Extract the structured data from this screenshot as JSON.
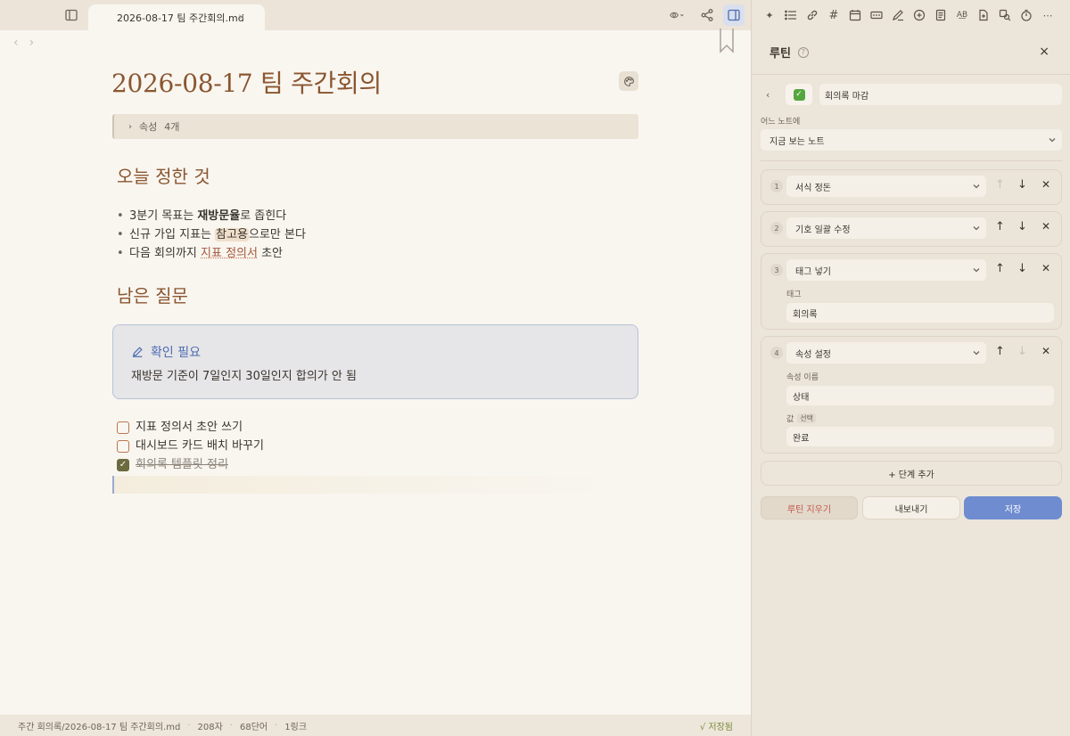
{
  "tab": {
    "title": "2026-08-17 팀 주간회의.md",
    "close": "×"
  },
  "editor": {
    "title": "2026-08-17 팀 주간회의",
    "properties": {
      "label": "속성",
      "count": "4개"
    },
    "heading1": "오늘 정한 것",
    "bullets": [
      {
        "pre": "3분기 목표는 ",
        "strong": "재방문율",
        "post": "로 좁힌다"
      },
      {
        "pre": "신규 가입 지표는 ",
        "mark": "참고용",
        "post": "으로만 본다"
      },
      {
        "pre": "다음 회의까지 ",
        "link": "지표 정의서",
        "post": " 초안"
      }
    ],
    "heading2": "남은 질문",
    "callout": {
      "title": "확인 필요",
      "body": "재방문 기준이 7일인지 30일인지 합의가 안 됨"
    },
    "tasks": [
      {
        "text": "지표 정의서 초안 쓰기",
        "done": false
      },
      {
        "text": "대시보드 카드 배치 바꾸기",
        "done": false
      },
      {
        "text": "회의록 템플릿 정리",
        "done": true
      }
    ]
  },
  "status": {
    "path": "주간 회의록/2026-08-17 팀 주간회의.md",
    "chars": "208자",
    "words": "68단어",
    "links": "1링크",
    "saved": "√ 저장됨"
  },
  "panel": {
    "title": "루틴",
    "close": "×",
    "routine_name": "회의록 마감",
    "target_label": "어느 노트에",
    "target_value": "지금 보는 노트",
    "steps": [
      {
        "num": "1",
        "action": "서식 정돈",
        "up_enabled": false,
        "down_enabled": true
      },
      {
        "num": "2",
        "action": "기호 일괄 수정",
        "up_enabled": true,
        "down_enabled": true
      },
      {
        "num": "3",
        "action": "태그 넣기",
        "up_enabled": true,
        "down_enabled": true,
        "field_label": "태그",
        "field_value": "회의록"
      },
      {
        "num": "4",
        "action": "속성 설정",
        "up_enabled": true,
        "down_enabled": false,
        "field_label": "속성 이름",
        "field_value": "상태",
        "field2_label": "값",
        "field2_optional": "선택",
        "field2_value": "완료"
      }
    ],
    "add_step": "+ 단계 추가",
    "btn_clear": "루틴 지우기",
    "btn_export": "내보내기",
    "btn_save": "저장"
  },
  "icons": {
    "toolbar": [
      "sparkle-icon",
      "list-icon",
      "link-icon",
      "hash-icon",
      "calendar-icon",
      "badge-icon",
      "pen-icon",
      "chat-plus-icon",
      "document-icon",
      "spellcheck-icon",
      "file-icon",
      "search-replace-icon",
      "timer-icon",
      "more-icon"
    ]
  },
  "colors": {
    "accent": "#6e8ccf",
    "heading": "#8a5630",
    "danger": "#c2574a"
  }
}
